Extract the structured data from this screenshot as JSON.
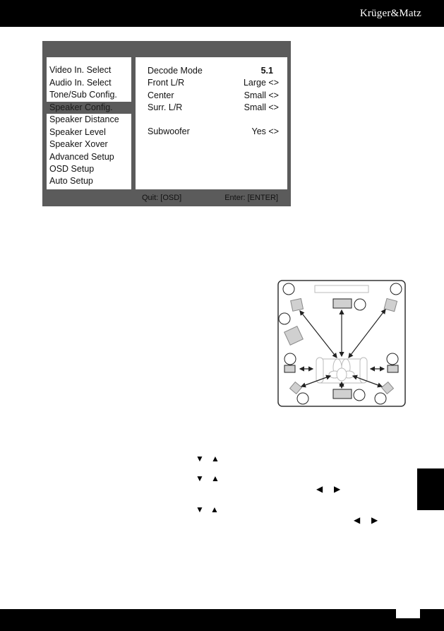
{
  "header": {
    "brand": "Krüger&Matz"
  },
  "osd": {
    "menu": [
      {
        "label": "Video In. Select",
        "selected": false
      },
      {
        "label": "Audio In. Select",
        "selected": false
      },
      {
        "label": "Tone/Sub Config.",
        "selected": false
      },
      {
        "label": "Speaker Config.",
        "selected": true
      },
      {
        "label": "Speaker Distance",
        "selected": false
      },
      {
        "label": "Speaker Level",
        "selected": false
      },
      {
        "label": "Speaker Xover",
        "selected": false
      },
      {
        "label": "Advanced Setup",
        "selected": false
      },
      {
        "label": "OSD Setup",
        "selected": false
      },
      {
        "label": "Auto Setup",
        "selected": false
      }
    ],
    "options": [
      {
        "label": "Decode Mode",
        "value": "5.1"
      },
      {
        "label": "Front L/R",
        "value": "Large <>"
      },
      {
        "label": "Center",
        "value": "Small <>"
      },
      {
        "label": "Surr. L/R",
        "value": "Small <>"
      },
      {
        "label": "Subwoofer",
        "value": "Yes <>"
      }
    ],
    "footer": {
      "quit": "Quit: [OSD]",
      "enter": "Enter: [ENTER]"
    }
  },
  "instructions": {
    "glyphs": {
      "down": "▼",
      "up": "▲",
      "left": "◀",
      "right": "▶"
    }
  },
  "colors": {
    "osd_gray": "#5b5b5b",
    "speaker_fill": "#d0d0d0",
    "black": "#000000"
  }
}
